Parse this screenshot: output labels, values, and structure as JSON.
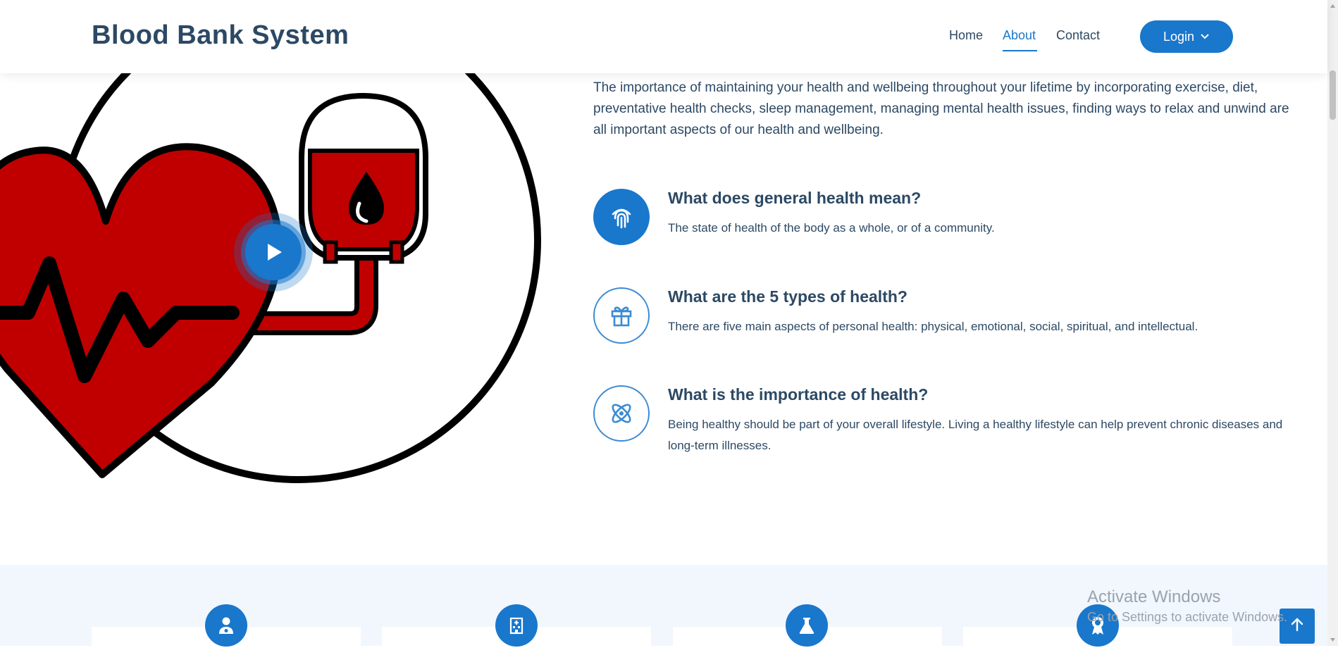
{
  "header": {
    "logo": "Blood Bank System",
    "nav": [
      {
        "label": "Home"
      },
      {
        "label": "About",
        "active": true
      },
      {
        "label": "Contact"
      }
    ],
    "login_label": "Login",
    "login_icon": "chevron-down-icon"
  },
  "about": {
    "intro": "The importance of maintaining your health and wellbeing throughout your lifetime by incorporating exercise, diet, preventative health checks, sleep management, managing mental health issues, finding ways to relax and unwind are all important aspects of our health and wellbeing.",
    "features": [
      {
        "icon": "fingerprint-icon",
        "title": "What does general health mean?",
        "description": "The state of health of the body as a whole, or of a community."
      },
      {
        "icon": "gift-icon",
        "title": "What are the 5 types of health?",
        "description": "There are five main aspects of personal health: physical, emotional, social, spiritual, and intellectual."
      },
      {
        "icon": "atom-icon",
        "title": "What is the importance of health?",
        "description": "Being healthy should be part of your overall lifestyle. Living a healthy lifestyle can help prevent chronic diseases and long-term illnesses."
      }
    ]
  },
  "stats": {
    "icons": [
      "doctor-icon",
      "hospital-icon",
      "flask-icon",
      "award-icon"
    ]
  },
  "watermark": {
    "title": "Activate Windows",
    "subtitle": "Go to Settings to activate Windows."
  },
  "colors": {
    "primary": "#1977cc",
    "heading": "#2c4964",
    "blood_red": "#c00000",
    "band": "#f1f7fd"
  }
}
